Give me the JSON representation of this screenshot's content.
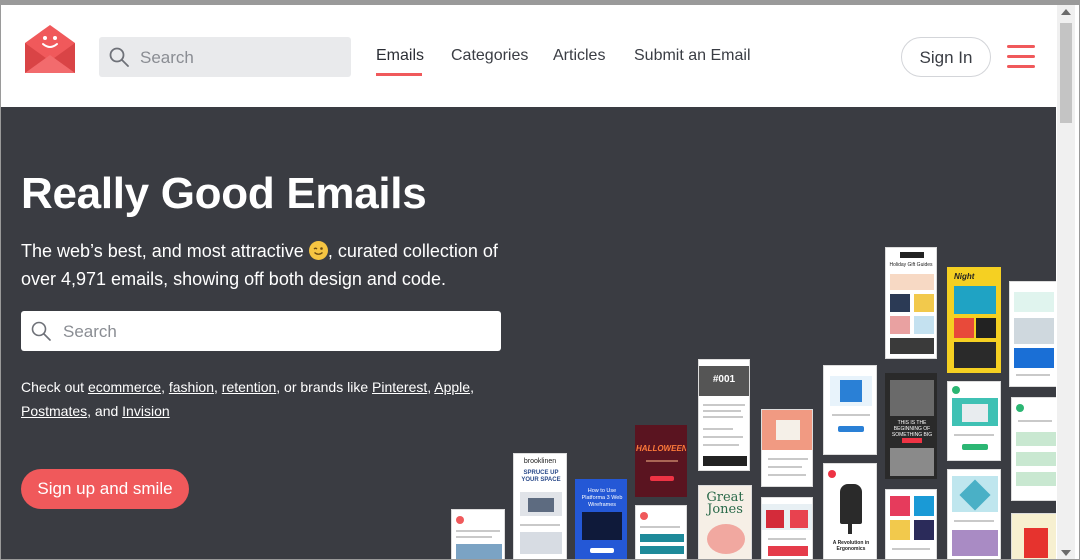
{
  "header": {
    "search_placeholder": "Search",
    "nav": [
      {
        "label": "Emails",
        "active": true
      },
      {
        "label": "Categories",
        "active": false
      },
      {
        "label": "Articles",
        "active": false
      },
      {
        "label": "Submit an Email",
        "active": false
      }
    ],
    "signin_label": "Sign In",
    "menu_icon": "hamburger-icon",
    "logo_icon": "envelope-smile-logo"
  },
  "hero": {
    "title": "Really Good Emails",
    "tagline_part1": "The web’s best, and most attractive",
    "tagline_part2": ", curated collection of over 4,971 emails, showing off both design and code.",
    "emoji": "winking-face-icon",
    "search_placeholder": "Search",
    "quick_intro": "Check out",
    "links": {
      "ecommerce": "ecommerce",
      "fashion": "fashion",
      "retention": "retention",
      "brands_text": ", or brands like",
      "pinterest": "Pinterest",
      "apple": "Apple",
      "postmates": "Postmates",
      "and_text": ", and",
      "invision": "Invision"
    },
    "cta_label": "Sign up and smile",
    "thumbnail_texts": {
      "t_001": "#001",
      "t_halloween": "HALLOWEEN",
      "t_great_jones": "Great Jones",
      "t_brooklinen": "brooklinen",
      "t_spruce": "SPRUCE UP YOUR SPACE",
      "t_ergonomics": "A Revolution in Ergonomics",
      "t_holiday": "Holiday Gift Guides",
      "t_night": "Night",
      "t_beginning": "THIS IS THE BEGINNING OF SOMETHING BIG",
      "t_platforma": "How to Use Platforma 3 Web Wireframes"
    }
  },
  "colors": {
    "accent": "#f0595b",
    "hero_bg": "#3a3c42",
    "search_bg": "#e9eaec",
    "text_dark": "#3a3d44"
  }
}
